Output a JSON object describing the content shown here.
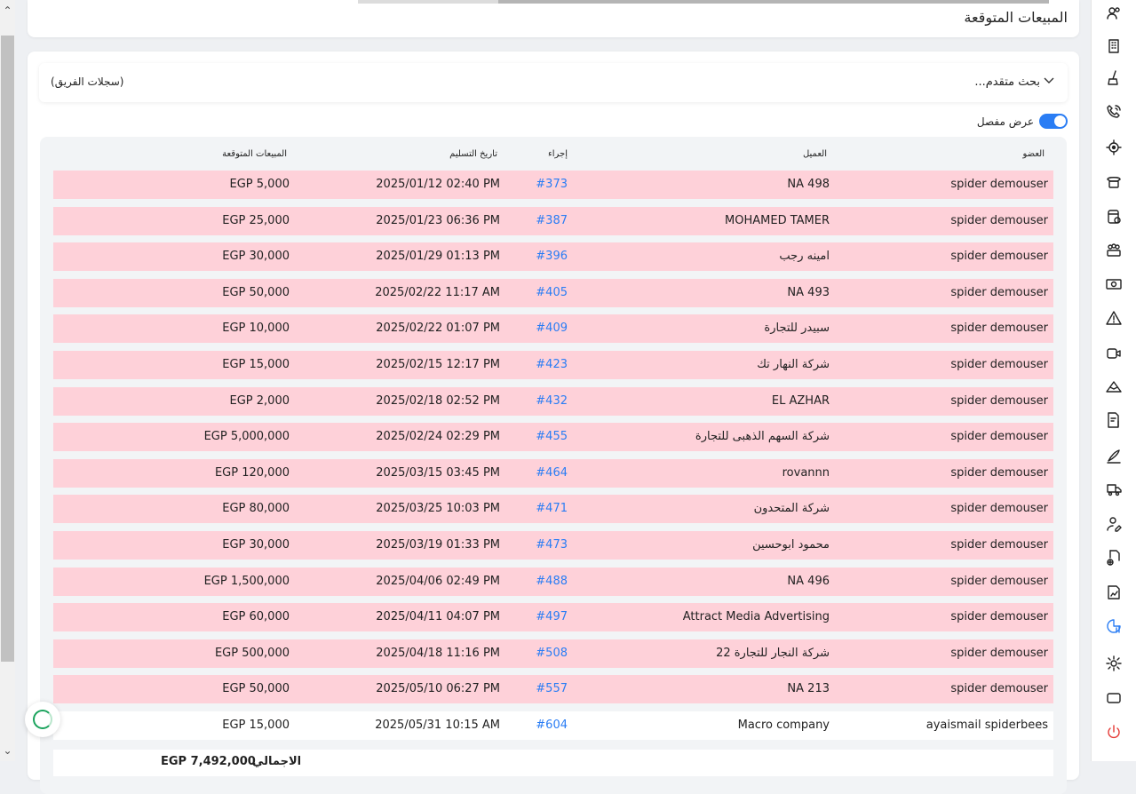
{
  "page": {
    "title": "المبيعات المتوقعة"
  },
  "filters": {
    "advanced_search": "بحث متقدم...",
    "team_records": "(سجلات الفريق)"
  },
  "toggle": {
    "label": "عرض مفصل",
    "on": true
  },
  "table": {
    "headers": {
      "member": "العضو",
      "client": "العميل",
      "action": "إجراء",
      "delivery_date": "تاريخ التسليم",
      "expected_sales": "المبيعات المتوقعة"
    },
    "rows": [
      {
        "member": "spider demouser",
        "client": "NA 498",
        "action": "#373",
        "date": "2025/01/12 02:40 PM",
        "sales": "EGP 5,000"
      },
      {
        "member": "spider demouser",
        "client": "MOHAMED TAMER",
        "action": "#387",
        "date": "2025/01/23 06:36 PM",
        "sales": "EGP 25,000"
      },
      {
        "member": "spider demouser",
        "client": "امينه رجب",
        "action": "#396",
        "date": "2025/01/29 01:13 PM",
        "sales": "EGP 30,000"
      },
      {
        "member": "spider demouser",
        "client": "NA 493",
        "action": "#405",
        "date": "2025/02/22 11:17 AM",
        "sales": "EGP 50,000"
      },
      {
        "member": "spider demouser",
        "client": "سبيدر للتجارة",
        "action": "#409",
        "date": "2025/02/22 01:07 PM",
        "sales": "EGP 10,000"
      },
      {
        "member": "spider demouser",
        "client": "شركة النهار تك",
        "action": "#423",
        "date": "2025/02/15 12:17 PM",
        "sales": "EGP 15,000"
      },
      {
        "member": "spider demouser",
        "client": "EL AZHAR",
        "action": "#432",
        "date": "2025/02/18 02:52 PM",
        "sales": "EGP 2,000"
      },
      {
        "member": "spider demouser",
        "client": "شركة السهم الذهبى للتجارة",
        "action": "#455",
        "date": "2025/02/24 02:29 PM",
        "sales": "EGP 5,000,000"
      },
      {
        "member": "spider demouser",
        "client": "rovannn",
        "action": "#464",
        "date": "2025/03/15 03:45 PM",
        "sales": "EGP 120,000"
      },
      {
        "member": "spider demouser",
        "client": "شركة المتحدون",
        "action": "#471",
        "date": "2025/03/25 10:03 PM",
        "sales": "EGP 80,000"
      },
      {
        "member": "spider demouser",
        "client": "محمود ابوحسين",
        "action": "#473",
        "date": "2025/03/19 01:33 PM",
        "sales": "EGP 30,000"
      },
      {
        "member": "spider demouser",
        "client": "NA 496",
        "action": "#488",
        "date": "2025/04/06 02:49 PM",
        "sales": "EGP 1,500,000"
      },
      {
        "member": "spider demouser",
        "client": "Attract Media Advertising",
        "action": "#497",
        "date": "2025/04/11 04:07 PM",
        "sales": "EGP 60,000"
      },
      {
        "member": "spider demouser",
        "client": "شركة النجار للتجارة 22",
        "action": "#508",
        "date": "2025/04/18 11:16 PM",
        "sales": "EGP 500,000"
      },
      {
        "member": "spider demouser",
        "client": "NA 213",
        "action": "#557",
        "date": "2025/05/10 06:27 PM",
        "sales": "EGP 50,000"
      },
      {
        "member": "ayaismail spiderbees",
        "client": "Macro company",
        "action": "#604",
        "date": "2025/05/31 10:15 AM",
        "sales": "EGP 15,000"
      }
    ],
    "total": {
      "label": "الاجمالي",
      "value": "EGP 7,492,000"
    }
  },
  "sidebar": {
    "icons": [
      "users-icon",
      "building-icon",
      "cleaning-icon",
      "phone-icon",
      "target-icon",
      "landline-icon",
      "database-settings-icon",
      "team-icon",
      "money-icon",
      "warning-icon",
      "video-icon",
      "mountain-icon",
      "invoice-icon",
      "signature-icon",
      "truck-icon",
      "user-edit-icon",
      "add-document-icon",
      "report-icon",
      "chart-icon",
      "settings-icon",
      "window-icon",
      "power-icon"
    ],
    "active_icon": "chart-icon"
  },
  "colors": {
    "row_highlight": "#fed1d9",
    "accent": "#2a7df4",
    "power": "#e53935"
  }
}
